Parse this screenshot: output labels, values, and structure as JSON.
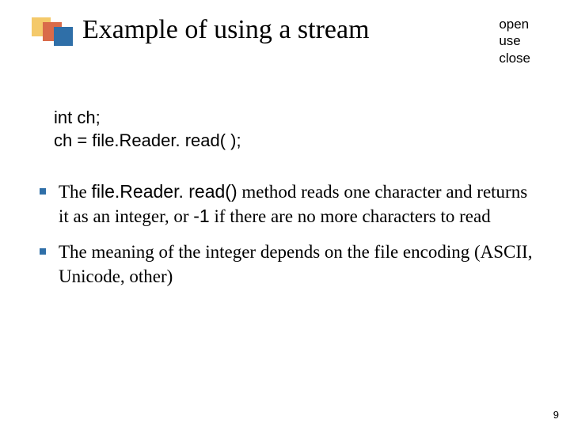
{
  "header": {
    "title": "Example of using a stream",
    "mini": [
      "open",
      "use",
      "close"
    ]
  },
  "code": {
    "line1": "int ch;",
    "line2": "ch = file.Reader. read( );"
  },
  "bullets": [
    {
      "pre": "The ",
      "mono1": "file.Reader. read()",
      "mid": " method reads one character and returns it as an integer, or ",
      "mono2": "-1",
      "post": " if there are no more characters to read"
    },
    {
      "pre": "The meaning of the integer depends on the file encoding (ASCII, Unicode, other)",
      "mono1": "",
      "mid": "",
      "mono2": "",
      "post": ""
    }
  ],
  "page_number": "9"
}
